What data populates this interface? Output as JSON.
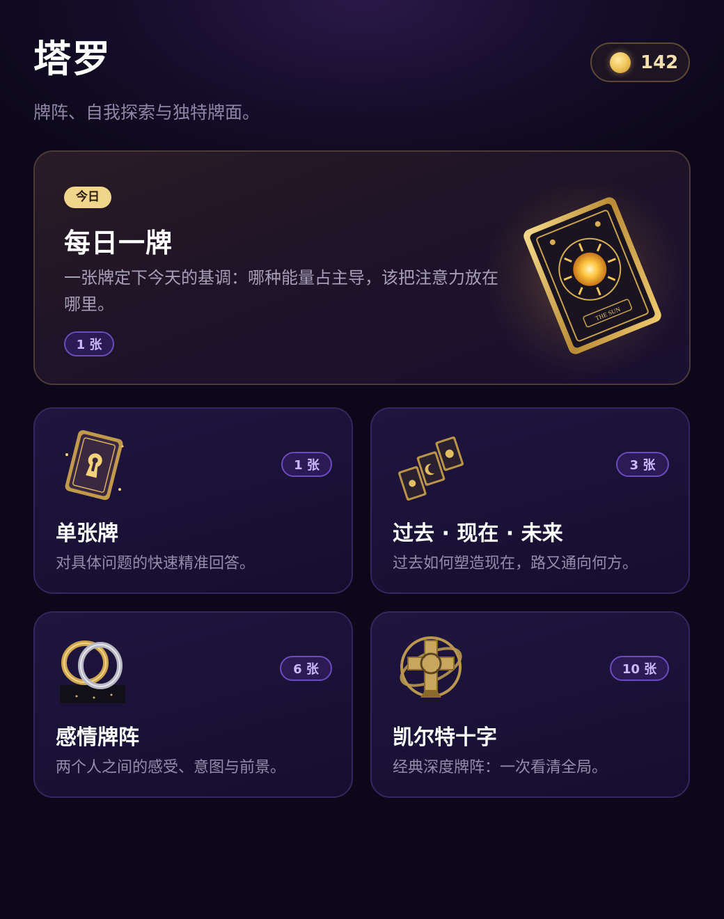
{
  "header": {
    "title": "塔罗",
    "subtitle": "牌阵、自我探索与独特牌面。",
    "coins": "142"
  },
  "daily": {
    "badge": "今日",
    "title": "每日一牌",
    "description": "一张牌定下今天的基调：哪种能量占主导，该把注意力放在哪里。",
    "count": "1 张",
    "card_caption": "THE SUN",
    "icon": "sun-tarot-card-icon"
  },
  "spreads": [
    {
      "title": "单张牌",
      "description": "对具体问题的快速精准回答。",
      "count": "1 张",
      "icon": "keyhole-card-icon"
    },
    {
      "title": "过去 · 现在 · 未来",
      "description": "过去如何塑造现在，路又通向何方。",
      "count": "3 张",
      "icon": "three-cards-icon"
    },
    {
      "title": "感情牌阵",
      "description": "两个人之间的感受、意图与前景。",
      "count": "6 张",
      "icon": "interlocked-rings-icon"
    },
    {
      "title": "凯尔特十字",
      "description": "经典深度牌阵：一次看清全局。",
      "count": "10 张",
      "icon": "celtic-cross-icon"
    }
  ],
  "colors": {
    "accent_gold": "#f0d58a",
    "pill_purple": "#2b1b55",
    "background": "#0c0819"
  }
}
